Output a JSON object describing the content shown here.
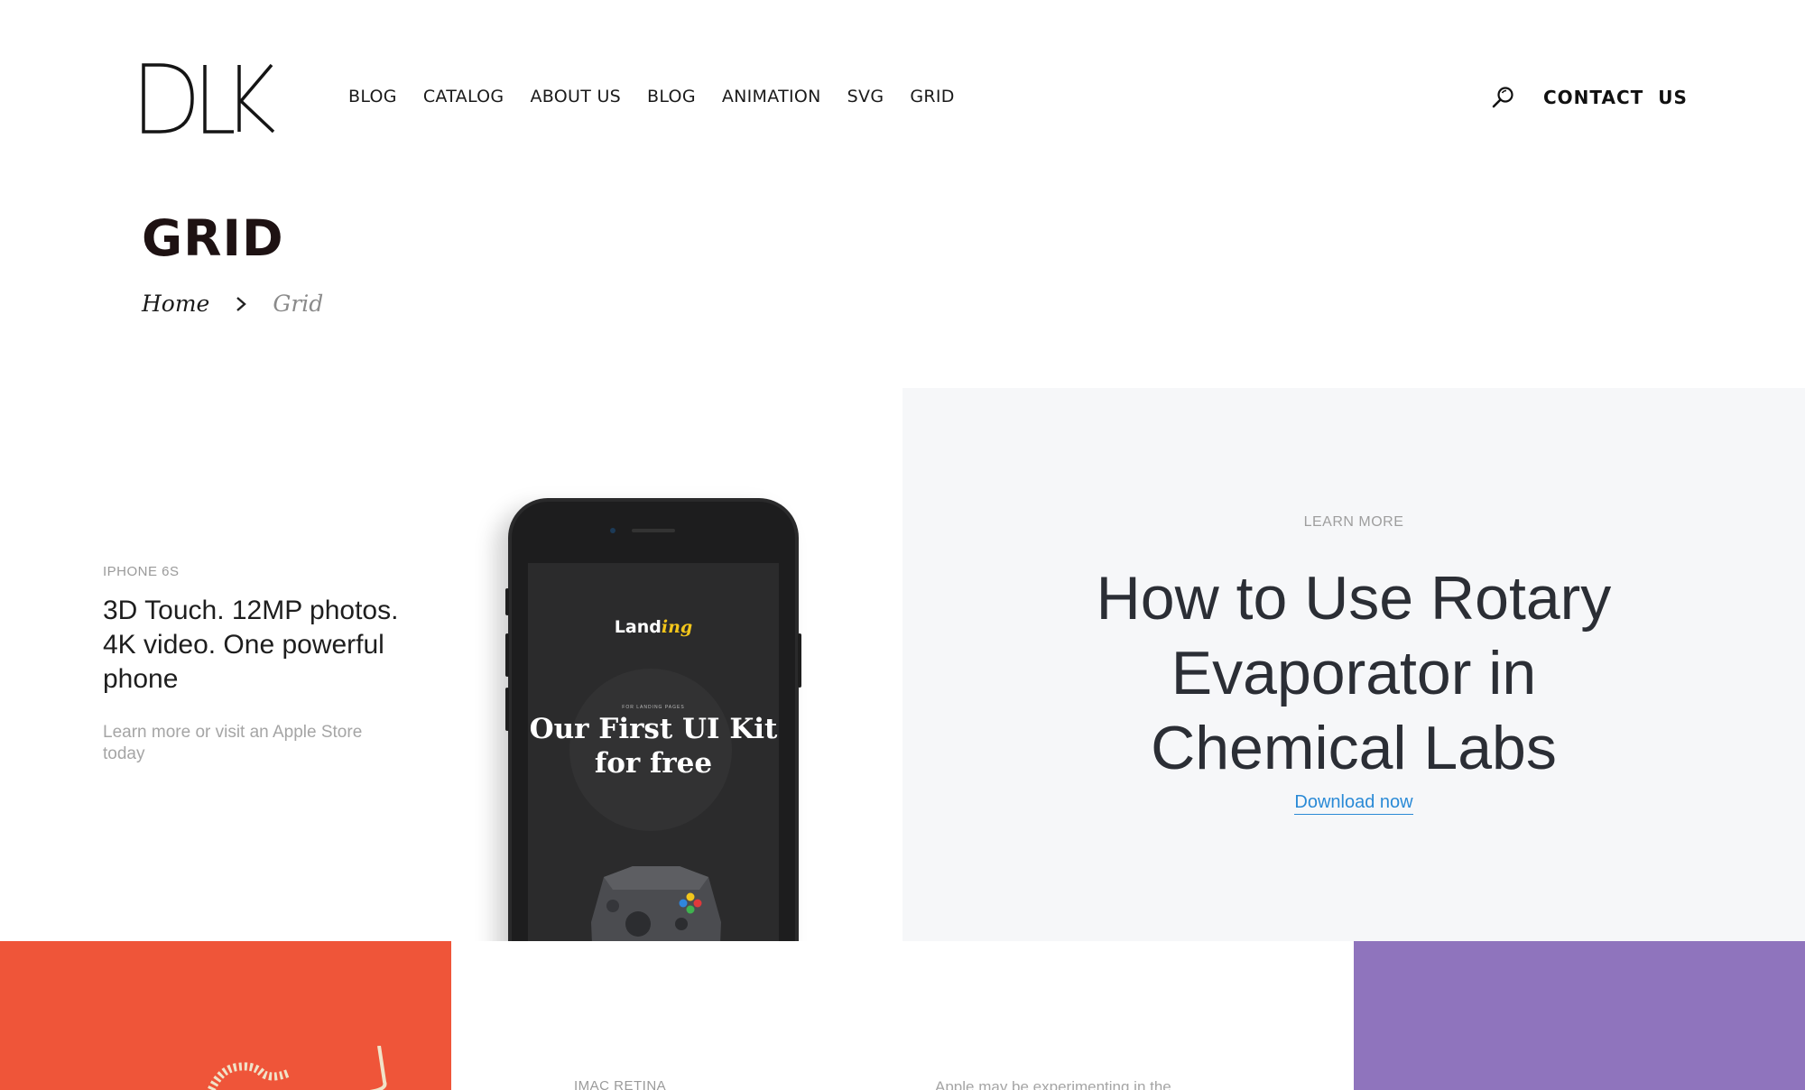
{
  "header": {
    "logo_text": "DLK",
    "nav": [
      "BLOG",
      "CATALOG",
      "ABOUT US",
      "BLOG",
      "ANIMATION",
      "SVG",
      "GRID"
    ],
    "search_icon": "search-icon",
    "contact_label": "CONTACT  US"
  },
  "page": {
    "title": "GRID",
    "breadcrumb": {
      "home": "Home",
      "separator_icon": "chevron-right-icon",
      "current": "Grid"
    }
  },
  "tiles": {
    "phone": {
      "eyebrow": "IPHONE 6S",
      "heading": "3D Touch. 12MP photos. 4K video. One powerful phone",
      "sub": "Learn more or visit an Apple Store today",
      "screen": {
        "app_name_a": "Land",
        "app_name_b": "ing",
        "tagline_small": "FOR LANDING PAGES",
        "title": "Our First UI Kit for free",
        "gamepad_icon": "gamepad-icon"
      }
    },
    "article": {
      "eyebrow": "LEARN MORE",
      "title": "How to Use Rotary Evaporator in Chemical Labs",
      "link": "Download now",
      "link_color": "#2a8ad6"
    },
    "red": {
      "color": "#ef5539"
    },
    "imac": {
      "eyebrow": "IMAC RETINA",
      "text": "Apple may be experimenting in the"
    },
    "purple": {
      "color": "#8f74bd"
    }
  }
}
